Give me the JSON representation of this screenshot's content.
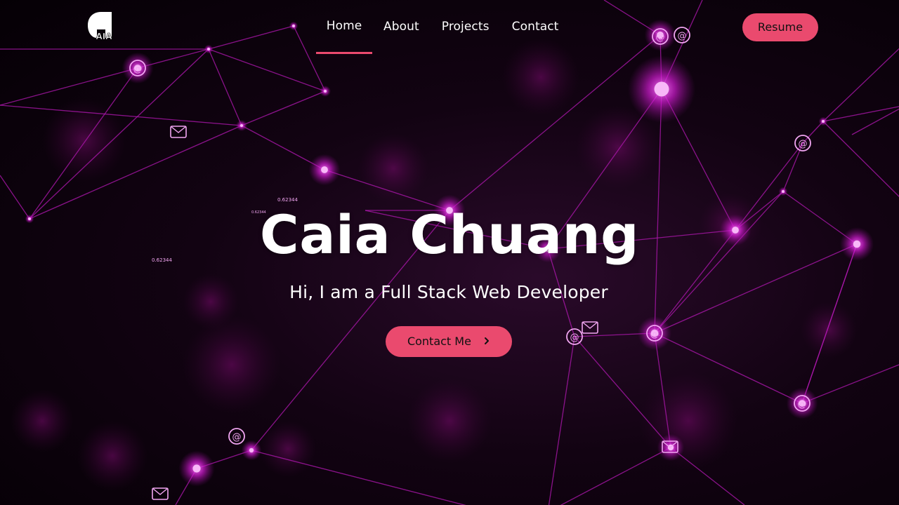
{
  "header": {
    "logo_text": "AIA",
    "nav": [
      {
        "label": "Home"
      },
      {
        "label": "About"
      },
      {
        "label": "Projects"
      },
      {
        "label": "Contact"
      }
    ],
    "resume_label": "Resume"
  },
  "hero": {
    "title": "Caia Chuang",
    "subtitle": "Hi, I am a Full Stack Web Developer",
    "cta_label": "Contact Me",
    "cta_icon": "chevron-right-icon"
  },
  "background": {
    "labels": [
      "0.62344",
      "0.62344",
      "0.62344"
    ]
  },
  "colors": {
    "accent": "#ea4a6e",
    "network": "#c21cc2",
    "background": "#050005"
  }
}
